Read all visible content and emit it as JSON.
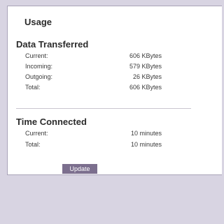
{
  "usage": {
    "title": "Usage"
  },
  "data_transferred": {
    "title": "Data Transferred",
    "rows": [
      {
        "label": "Current:",
        "value": "606 KBytes"
      },
      {
        "label": "Incoming:",
        "value": "579 KBytes"
      },
      {
        "label": "Outgoing:",
        "value": "26 KBytes"
      },
      {
        "label": "Total:",
        "value": "606 KBytes"
      }
    ]
  },
  "time_connected": {
    "title": "Time Connected",
    "rows": [
      {
        "label": "Current:",
        "value": "10 minutes"
      },
      {
        "label": "Total:",
        "value": "10 minutes"
      }
    ]
  },
  "actions": {
    "update_label": "Update"
  },
  "colors": {
    "page_background": "#d8d4e2",
    "panel_background": "#ffffff",
    "button_background": "#7c6f8e"
  }
}
